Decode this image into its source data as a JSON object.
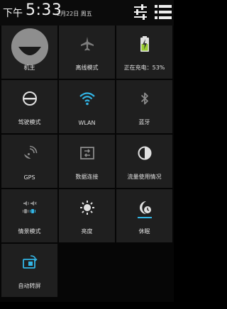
{
  "status_bar": {
    "ampm": "下午",
    "time": "5:33",
    "date": "2月22日 周五"
  },
  "tiles": {
    "owner": {
      "label": "机主",
      "icon": "avatar"
    },
    "airplane": {
      "label": "离线模式",
      "icon": "airplane-icon"
    },
    "battery": {
      "label": "正在充电：53%",
      "icon": "battery-charging-icon"
    },
    "driving": {
      "label": "驾驶模式",
      "icon": "steering-wheel-icon"
    },
    "wlan": {
      "label": "WLAN",
      "icon": "wifi-icon"
    },
    "bluetooth": {
      "label": "蓝牙",
      "icon": "bluetooth-icon"
    },
    "gps": {
      "label": "GPS",
      "icon": "satellite-icon"
    },
    "data": {
      "label": "数据连接",
      "icon": "data-connection-icon"
    },
    "usage": {
      "label": "流量使用情况",
      "icon": "data-usage-icon"
    },
    "profile": {
      "label": "情景模式",
      "icon": "sound-profile-icon"
    },
    "brightness": {
      "label": "亮度",
      "icon": "brightness-icon"
    },
    "sleep": {
      "label": "休眠",
      "icon": "sleep-icon"
    },
    "rotate": {
      "label": "自动转屏",
      "icon": "auto-rotate-icon"
    }
  },
  "colors": {
    "accent": "#32b5e5",
    "battery": "#9acd32",
    "tile_bg": "#1f1f1f"
  }
}
